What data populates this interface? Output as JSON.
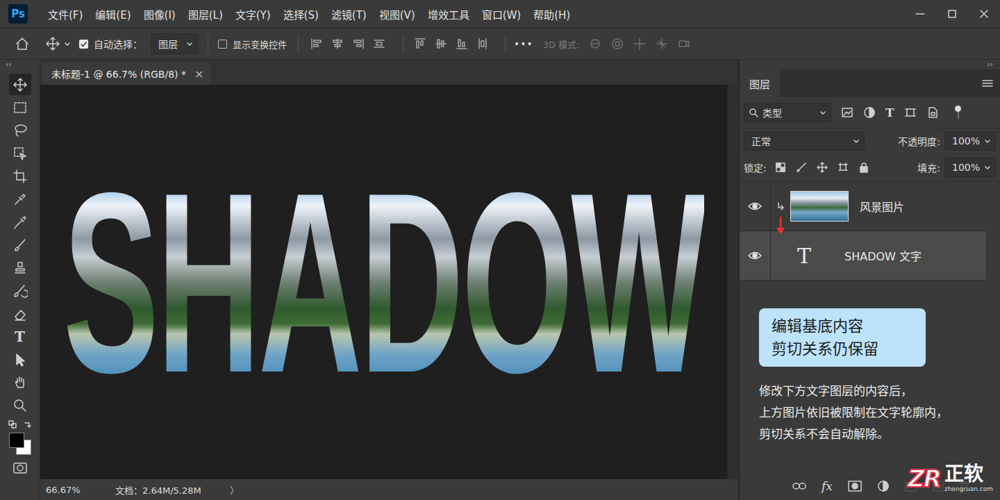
{
  "app": {
    "logo": "Ps"
  },
  "menu": [
    "文件(F)",
    "编辑(E)",
    "图像(I)",
    "图层(L)",
    "文字(Y)",
    "选择(S)",
    "滤镜(T)",
    "视图(V)",
    "增效工具",
    "窗口(W)",
    "帮助(H)"
  ],
  "options_bar": {
    "auto_select": {
      "label": "自动选择：",
      "checked": true
    },
    "auto_select_target": "图层",
    "show_transform": {
      "label": "显示变换控件",
      "checked": false
    },
    "more": "•••",
    "mode_3d": {
      "label": "3D 模式:",
      "disabled": true
    }
  },
  "collapse_left": "‹‹",
  "collapse_right": "››",
  "toolbar": {
    "tools": [
      {
        "kind": "move",
        "selected": true
      },
      {
        "kind": "marquee",
        "selected": false
      },
      {
        "kind": "lasso",
        "selected": false
      },
      {
        "kind": "objectselect",
        "selected": false
      },
      {
        "kind": "crop",
        "selected": false
      },
      {
        "kind": "eyedropper",
        "selected": false
      },
      {
        "kind": "healing",
        "selected": false
      },
      {
        "kind": "brush",
        "selected": false
      },
      {
        "kind": "stamp",
        "selected": false
      },
      {
        "kind": "historybrush",
        "selected": false
      },
      {
        "kind": "eraser",
        "selected": false
      },
      {
        "kind": "type",
        "selected": false,
        "glyph": "T"
      },
      {
        "kind": "pathselect",
        "selected": false
      },
      {
        "kind": "hand",
        "selected": false
      },
      {
        "kind": "zoom",
        "selected": false
      }
    ]
  },
  "document": {
    "tab_title": "未标题-1 @ 66.7% (RGB/8) *",
    "close": "×",
    "canvas_text": "SHADOW"
  },
  "status_bar": {
    "zoom": "66.67%",
    "doc": "文档：2.64M/5.28M",
    "arrow": "〉"
  },
  "layers_panel": {
    "title": "图层",
    "filter": "类型",
    "filter_type_glyph": "T",
    "blend": "正常",
    "opacity_label": "不透明度:",
    "opacity": "100%",
    "lock_label": "锁定:",
    "fill_label": "填充:",
    "fill": "100%",
    "layers": [
      {
        "name": "风景图片",
        "kind": "image",
        "visible": true,
        "clipped": true,
        "selected": false
      },
      {
        "name": "SHADOW 文字",
        "kind": "text",
        "visible": true,
        "clipped": false,
        "selected": true,
        "thumb_glyph": "T"
      }
    ],
    "callout": [
      "编辑基底内容",
      "剪切关系仍保留"
    ],
    "description": [
      "修改下方文字图层的内容后，",
      "上方图片依旧被限制在文字轮廓内，",
      "剪切关系不会自动解除。"
    ],
    "footer_fx": "fx"
  },
  "watermark": {
    "logo": "ZR",
    "name": "正软",
    "url": "zhengruan.com"
  }
}
